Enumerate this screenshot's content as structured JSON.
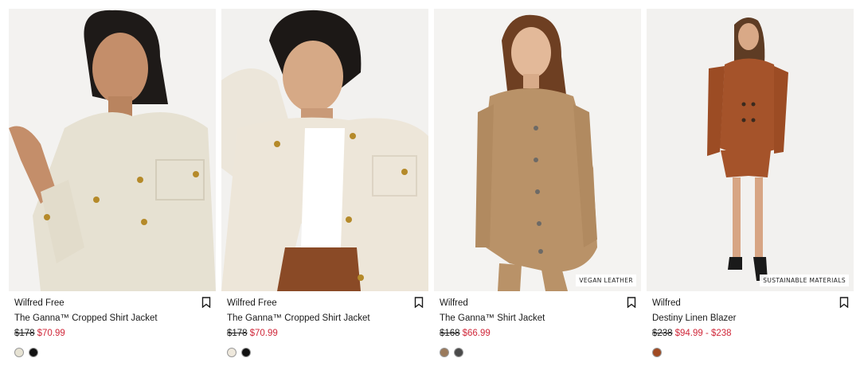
{
  "products": [
    {
      "brand": "Wilfred Free",
      "name": "The Ganna™ Cropped Shirt Jacket",
      "old_price": "$178",
      "sale_price": "$70.99",
      "tag": "",
      "swatches": [
        "#e6e2d3",
        "#111111"
      ]
    },
    {
      "brand": "Wilfred Free",
      "name": "The Ganna™ Cropped Shirt Jacket",
      "old_price": "$178",
      "sale_price": "$70.99",
      "tag": "",
      "swatches": [
        "#eee8dc",
        "#111111"
      ]
    },
    {
      "brand": "Wilfred",
      "name": "The Ganna™ Shirt Jacket",
      "old_price": "$168",
      "sale_price": "$66.99",
      "tag": "VEGAN LEATHER",
      "swatches": [
        "#9a7a5c",
        "#4a4a4a"
      ]
    },
    {
      "brand": "Wilfred",
      "name": "Destiny Linen Blazer",
      "old_price": "$238",
      "sale_price": "$94.99 - $238",
      "tag": "SUSTAINABLE MATERIALS",
      "swatches": [
        "#a04a22"
      ]
    }
  ],
  "icons": {
    "save": "bookmark-icon"
  },
  "colors": {
    "sale": "#d0283a",
    "text": "#1a1a1a"
  }
}
